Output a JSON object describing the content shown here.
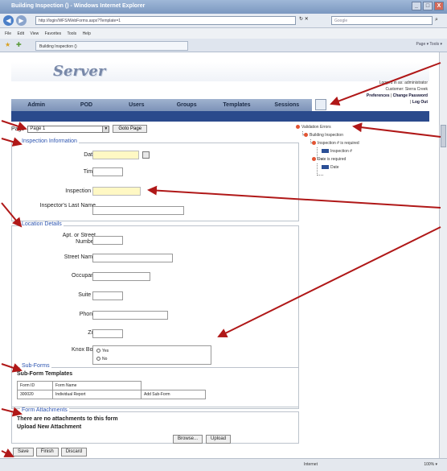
{
  "window": {
    "title": "Building Inspection () - Windows Internet Explorer",
    "controls": [
      "_",
      "□",
      "X"
    ]
  },
  "browser": {
    "address": "http://login/WFS/WebForms.aspx?Template=1",
    "search_placeholder": "Google",
    "menu": [
      "File",
      "Edit",
      "View",
      "Favorites",
      "Tools",
      "Help"
    ],
    "tab_title": "Building Inspection ()",
    "commands": "Page ▾  Tools ▾"
  },
  "app": {
    "logo": "Server",
    "user": {
      "logged_in": "Logged in as: administrator",
      "customer": "Customer: Sierra Creek",
      "preferences": "Preferences",
      "change_password": "Change Password",
      "logout": "Log Out"
    },
    "nav": [
      "Admin",
      "POD",
      "Users",
      "Groups",
      "Templates",
      "Sessions"
    ]
  },
  "pager": {
    "label": "Page",
    "selected": "Page 1",
    "go_button": "Goto Page"
  },
  "inspection": {
    "legend": "Inspection Information",
    "fields": [
      "Date",
      "Time",
      "Inspection #",
      "Inspector's Last Name"
    ]
  },
  "location": {
    "legend": "Location Details",
    "fields": [
      "Apt. or Street Number",
      "Street Name",
      "Occupant",
      "Suite #",
      "Phone",
      "Zip",
      "Knox Box"
    ],
    "knox_options": [
      "Yes",
      "No"
    ]
  },
  "subforms": {
    "legend": "Sub-Forms",
    "heading": "Sub-Form Templates",
    "columns": [
      "Form ID",
      "Form Name",
      ""
    ],
    "rows": [
      [
        "300020",
        "Individual Report",
        "Add Sub-Form"
      ]
    ]
  },
  "attachments": {
    "legend": "Form Attachments",
    "none_text": "There are no attachments to this form",
    "upload_label": "Upload New Attachment",
    "browse": "Browse...",
    "upload": "Upload"
  },
  "actions": [
    "Save",
    "Finish",
    "Discard"
  ],
  "tree": {
    "root": "Validation Errors",
    "form": "Building Inspection",
    "err1": "Inspection # is required",
    "err1_field": "Inspection #",
    "err2": "Date is required",
    "err2_field": "Date"
  },
  "status": {
    "zone": "Internet",
    "zoom": "100% ▾"
  },
  "colors": {
    "accent_blue": "#2a4a8c",
    "required_field": "#fff8c4",
    "annotation_arrow": "#b01818",
    "tree_error_dot": "#e25433"
  }
}
